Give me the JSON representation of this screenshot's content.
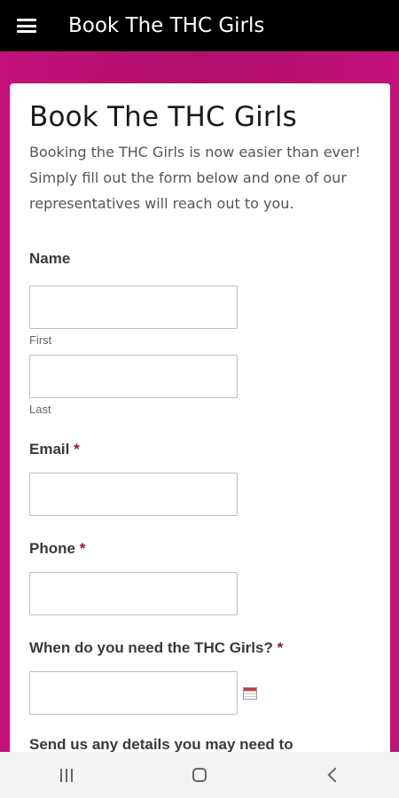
{
  "appbar": {
    "title": "Book The THC Girls",
    "menu_icon": "menu-icon"
  },
  "form": {
    "title": "Book The THC Girls",
    "description": "Booking the THC Girls is now easier than ever! Simply fill out the form below and one of our representatives will reach out to you.",
    "name": {
      "label": "Name",
      "first_sublabel": "First",
      "last_sublabel": "Last",
      "first_value": "",
      "last_value": ""
    },
    "email": {
      "label": "Email",
      "required": "*",
      "value": ""
    },
    "phone": {
      "label": "Phone",
      "required": "*",
      "value": ""
    },
    "date": {
      "label": "When do you need the THC Girls?",
      "required": "*",
      "value": "",
      "icon": "calendar-icon"
    },
    "next_label_partial": "Send us any details you may need to"
  },
  "navbar": {
    "recent_icon": "recent-apps-icon",
    "home_icon": "home-icon",
    "back_icon": "back-icon"
  },
  "colors": {
    "accent": "#b10f6e",
    "appbar": "#000000",
    "required": "#a0151c"
  }
}
